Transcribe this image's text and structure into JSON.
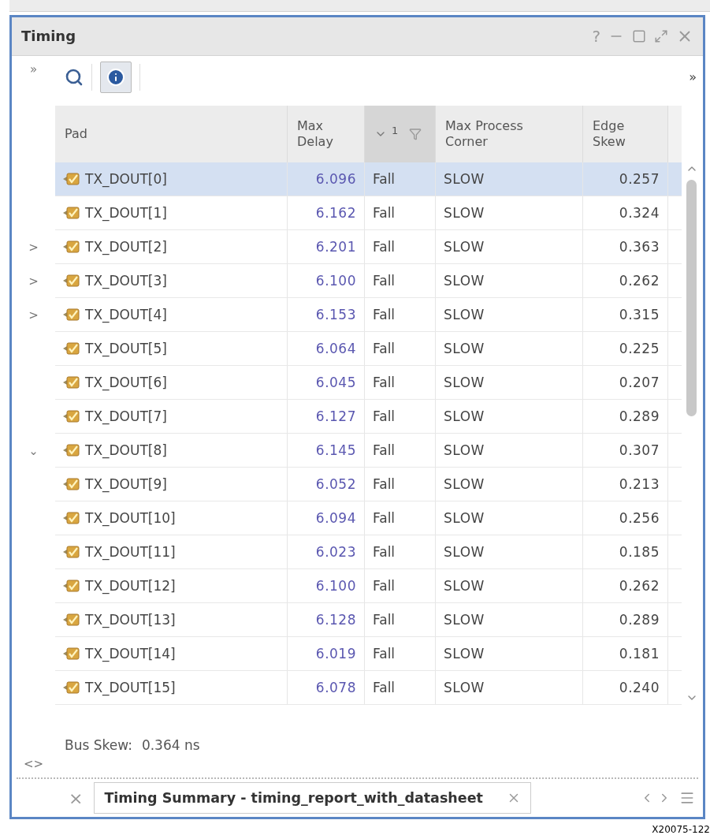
{
  "window": {
    "title": "Timing",
    "help": "?"
  },
  "toolbar": {
    "info_active": true,
    "overflow": "»",
    "left_marker": "»"
  },
  "table": {
    "columns": [
      {
        "label": "Pad"
      },
      {
        "label": "Max\nDelay"
      },
      {
        "label": "1",
        "sorted": true
      },
      {
        "label": "Max Process\nCorner"
      },
      {
        "label": "Edge\nSkew"
      }
    ],
    "rows": [
      {
        "pad": "TX_DOUT[0]",
        "max_delay": "6.096",
        "column_3": "Fall",
        "corner": "SLOW",
        "skew": "0.257",
        "selected": true
      },
      {
        "pad": "TX_DOUT[1]",
        "max_delay": "6.162",
        "column_3": "Fall",
        "corner": "SLOW",
        "skew": "0.324",
        "selected": false
      },
      {
        "pad": "TX_DOUT[2]",
        "max_delay": "6.201",
        "column_3": "Fall",
        "corner": "SLOW",
        "skew": "0.363",
        "selected": false,
        "gutter": ">"
      },
      {
        "pad": "TX_DOUT[3]",
        "max_delay": "6.100",
        "column_3": "Fall",
        "corner": "SLOW",
        "skew": "0.262",
        "selected": false,
        "gutter": ">"
      },
      {
        "pad": "TX_DOUT[4]",
        "max_delay": "6.153",
        "column_3": "Fall",
        "corner": "SLOW",
        "skew": "0.315",
        "selected": false,
        "gutter": ">"
      },
      {
        "pad": "TX_DOUT[5]",
        "max_delay": "6.064",
        "column_3": "Fall",
        "corner": "SLOW",
        "skew": "0.225",
        "selected": false
      },
      {
        "pad": "TX_DOUT[6]",
        "max_delay": "6.045",
        "column_3": "Fall",
        "corner": "SLOW",
        "skew": "0.207",
        "selected": false
      },
      {
        "pad": "TX_DOUT[7]",
        "max_delay": "6.127",
        "column_3": "Fall",
        "corner": "SLOW",
        "skew": "0.289",
        "selected": false
      },
      {
        "pad": "TX_DOUT[8]",
        "max_delay": "6.145",
        "column_3": "Fall",
        "corner": "SLOW",
        "skew": "0.307",
        "selected": false,
        "gutter": "⌄"
      },
      {
        "pad": "TX_DOUT[9]",
        "max_delay": "6.052",
        "column_3": "Fall",
        "corner": "SLOW",
        "skew": "0.213",
        "selected": false
      },
      {
        "pad": "TX_DOUT[10]",
        "max_delay": "6.094",
        "column_3": "Fall",
        "corner": "SLOW",
        "skew": "0.256",
        "selected": false
      },
      {
        "pad": "TX_DOUT[11]",
        "max_delay": "6.023",
        "column_3": "Fall",
        "corner": "SLOW",
        "skew": "0.185",
        "selected": false
      },
      {
        "pad": "TX_DOUT[12]",
        "max_delay": "6.100",
        "column_3": "Fall",
        "corner": "SLOW",
        "skew": "0.262",
        "selected": false
      },
      {
        "pad": "TX_DOUT[13]",
        "max_delay": "6.128",
        "column_3": "Fall",
        "corner": "SLOW",
        "skew": "0.289",
        "selected": false
      },
      {
        "pad": "TX_DOUT[14]",
        "max_delay": "6.019",
        "column_3": "Fall",
        "corner": "SLOW",
        "skew": "0.181",
        "selected": false
      },
      {
        "pad": "TX_DOUT[15]",
        "max_delay": "6.078",
        "column_3": "Fall",
        "corner": "SLOW",
        "skew": "0.240",
        "selected": false
      }
    ]
  },
  "summary": {
    "label": "Bus Skew:",
    "value": "0.364 ns",
    "gutter": "<>"
  },
  "tab_bar": {
    "close_all": "×",
    "tabs": [
      {
        "label": "Timing Summary - timing_report_with_datasheet",
        "selected": true
      }
    ]
  },
  "figure_label": "X20075-122"
}
